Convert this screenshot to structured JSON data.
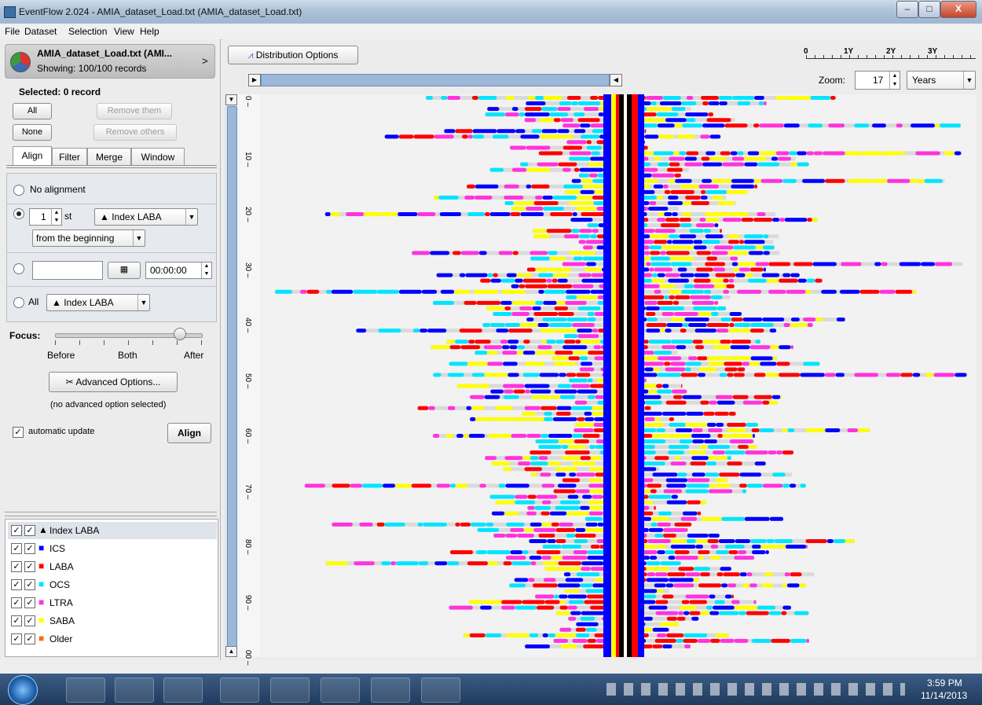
{
  "window": {
    "title": "EventFlow 2.024 - AMIA_dataset_Load.txt (AMIA_dataset_Load.txt)",
    "min": "–",
    "max": "□",
    "close": "X"
  },
  "menu": [
    "File",
    "Dataset",
    "Selection",
    "View",
    "Help"
  ],
  "dataset": {
    "name": "AMIA_dataset_Load.txt (AMI...",
    "showing": "Showing: 100/100 records",
    "chevron": ">"
  },
  "selection": {
    "label": "Selected: 0 record",
    "all": "All",
    "none": "None",
    "remove_them": "Remove them",
    "remove_others": "Remove others"
  },
  "tabs": [
    "Align",
    "Filter",
    "Merge",
    "Window"
  ],
  "align": {
    "no_alignment": "No alignment",
    "nth_value": "1",
    "nth_suffix": "st",
    "event_type": "▲ Index LABA",
    "from": "from the beginning",
    "date_value": "",
    "time_value": "00:00:00",
    "all_label": "All",
    "all_event": "▲ Index LABA"
  },
  "focus": {
    "label": "Focus:",
    "before": "Before",
    "both": "Both",
    "after": "After",
    "level": 0.85
  },
  "advanced": {
    "button": "Advanced Options...",
    "status": "(no advanced option selected)"
  },
  "auto_update": {
    "label": "automatic update",
    "checked": true
  },
  "align_button": "Align",
  "legend": [
    {
      "name": "Index LABA",
      "color": "#000000",
      "shape": "▲"
    },
    {
      "name": "ICS",
      "color": "#0000ff",
      "shape": "■"
    },
    {
      "name": "LABA",
      "color": "#ff0000",
      "shape": "■"
    },
    {
      "name": "OCS",
      "color": "#00e5ff",
      "shape": "■"
    },
    {
      "name": "LTRA",
      "color": "#ff33dd",
      "shape": "■"
    },
    {
      "name": "SABA",
      "color": "#ffff00",
      "shape": "■"
    },
    {
      "name": "Older",
      "color": "#ff6a1a",
      "shape": "■"
    }
  ],
  "toolbar": {
    "distribution_options": "Distribution Options",
    "zoom_label": "Zoom:",
    "zoom_value": "17",
    "zoom_unit": "Years",
    "time_ticks": [
      "0",
      "1Y",
      "2Y",
      "3Y"
    ]
  },
  "row_axis": {
    "ticks": [
      "0",
      "10",
      "20",
      "30",
      "40",
      "50",
      "60",
      "70",
      "80",
      "90",
      "00"
    ]
  },
  "taskbar": {
    "time": "3:59 PM",
    "date": "11/14/2013"
  }
}
